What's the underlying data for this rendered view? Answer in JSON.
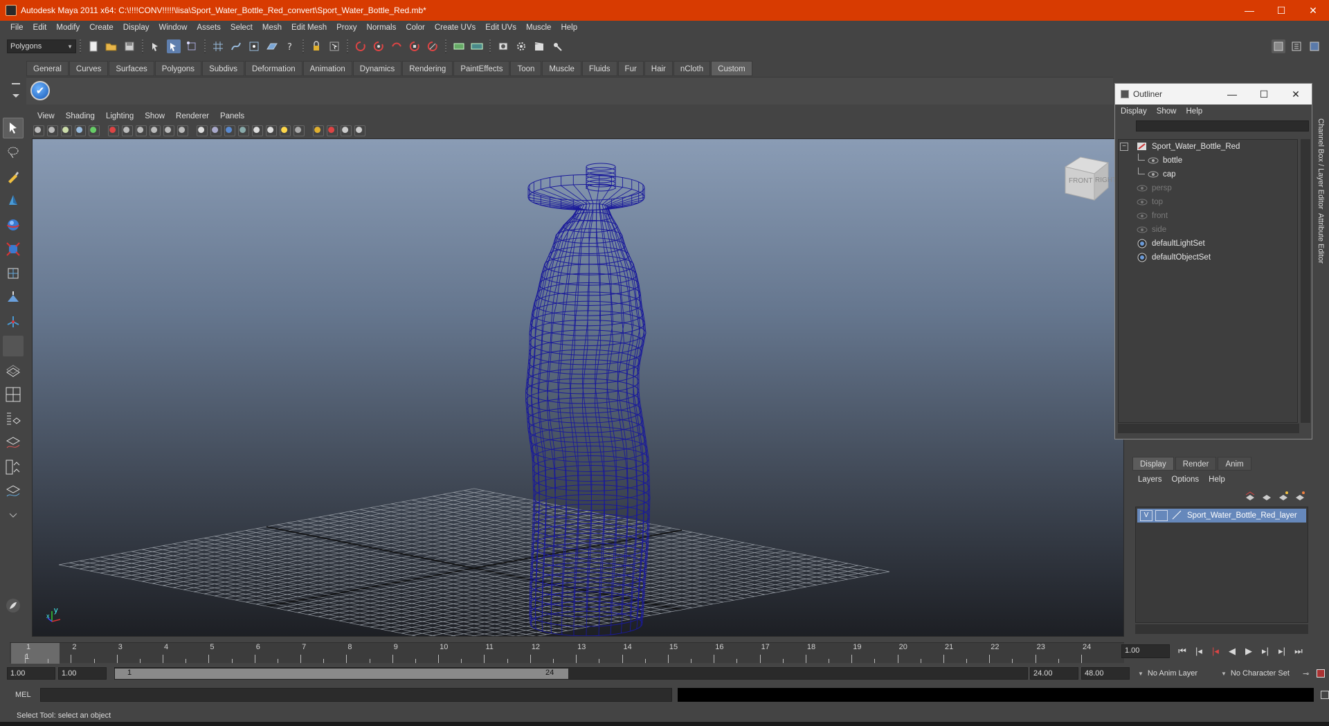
{
  "window": {
    "title": "Autodesk Maya 2011 x64: C:\\!!!!CONV!!!!!\\lisa\\Sport_Water_Bottle_Red_convert\\Sport_Water_Bottle_Red.mb*",
    "minimize": "—",
    "maximize": "☐",
    "close": "✕"
  },
  "menubar": [
    "File",
    "Edit",
    "Modify",
    "Create",
    "Display",
    "Window",
    "Assets",
    "Select",
    "Mesh",
    "Edit Mesh",
    "Proxy",
    "Normals",
    "Color",
    "Create UVs",
    "Edit UVs",
    "Muscle",
    "Help"
  ],
  "statusline": {
    "mode": "Polygons"
  },
  "shelf": {
    "tabs": [
      "General",
      "Curves",
      "Surfaces",
      "Polygons",
      "Subdivs",
      "Deformation",
      "Animation",
      "Dynamics",
      "Rendering",
      "PaintEffects",
      "Toon",
      "Muscle",
      "Fluids",
      "Fur",
      "Hair",
      "nCloth",
      "Custom"
    ],
    "active_tab": "Custom"
  },
  "panel": {
    "menus": [
      "View",
      "Shading",
      "Lighting",
      "Show",
      "Renderer",
      "Panels"
    ],
    "viewcube_front": "FRONT",
    "viewcube_right": "RIGHT",
    "axis_x": "x",
    "axis_y": "y"
  },
  "outliner": {
    "title": "Outliner",
    "menus": [
      "Display",
      "Show",
      "Help"
    ],
    "items": [
      {
        "label": "Sport_Water_Bottle_Red",
        "indent": 0,
        "dim": false
      },
      {
        "label": "bottle",
        "indent": 1,
        "dim": false
      },
      {
        "label": "cap",
        "indent": 1,
        "dim": false
      },
      {
        "label": "persp",
        "indent": 0,
        "dim": true
      },
      {
        "label": "top",
        "indent": 0,
        "dim": true
      },
      {
        "label": "front",
        "indent": 0,
        "dim": true
      },
      {
        "label": "side",
        "indent": 0,
        "dim": true
      },
      {
        "label": "defaultLightSet",
        "indent": 0,
        "dim": false
      },
      {
        "label": "defaultObjectSet",
        "indent": 0,
        "dim": false
      }
    ]
  },
  "layer_editor": {
    "tabs": [
      "Display",
      "Render",
      "Anim"
    ],
    "active_tab": "Display",
    "menus": [
      "Layers",
      "Options",
      "Help"
    ],
    "layer": {
      "visible": "V",
      "name": "Sport_Water_Bottle_Red_layer"
    }
  },
  "side_tabs": [
    "Channel Box / Layer Editor",
    "Attribute Editor"
  ],
  "timeline": {
    "ticks": [
      "1",
      "2",
      "3",
      "4",
      "5",
      "6",
      "7",
      "8",
      "9",
      "10",
      "11",
      "12",
      "13",
      "14",
      "15",
      "16",
      "17",
      "18",
      "19",
      "20",
      "21",
      "22",
      "23",
      "24"
    ],
    "current": "1",
    "current_field": "1.00"
  },
  "range": {
    "start": "1.00",
    "playback_start": "1.00",
    "handle_start": "1",
    "handle_end": "24",
    "playback_end": "24.00",
    "end": "48.00",
    "anim_layer": "No Anim Layer",
    "character_set": "No Character Set"
  },
  "command": {
    "label": "MEL"
  },
  "helpline": "Select Tool: select an object",
  "colors": {
    "titlebar": "#d83b01",
    "wireframe": "#1a1a9a",
    "layer_highlight": "#6688bb"
  }
}
